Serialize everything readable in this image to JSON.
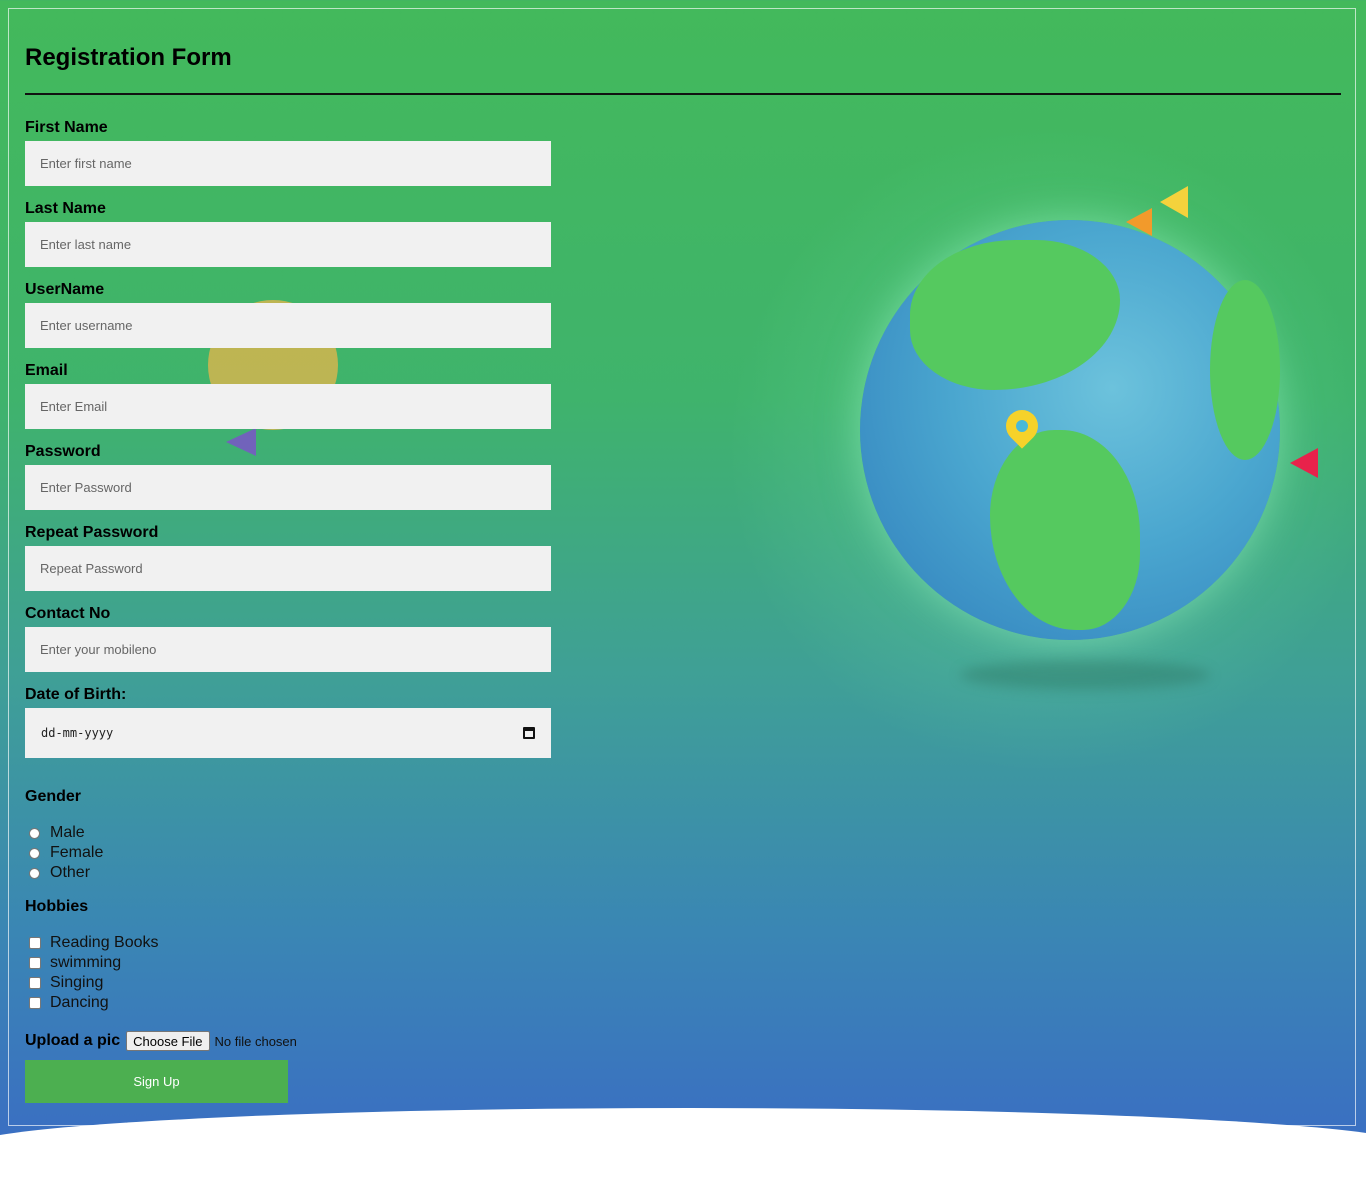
{
  "form": {
    "title": "Registration Form",
    "first_name": {
      "label": "First Name",
      "placeholder": "Enter first name"
    },
    "last_name": {
      "label": "Last Name",
      "placeholder": "Enter last name"
    },
    "username": {
      "label": "UserName",
      "placeholder": "Enter username"
    },
    "email": {
      "label": "Email",
      "placeholder": "Enter Email"
    },
    "password": {
      "label": "Password",
      "placeholder": "Enter Password"
    },
    "repeat_password": {
      "label": "Repeat Password",
      "placeholder": "Repeat Password"
    },
    "contact": {
      "label": "Contact No",
      "placeholder": "Enter your mobileno"
    },
    "dob": {
      "label": "Date of Birth:",
      "placeholder": "dd-mm-yyyy"
    },
    "gender": {
      "label": "Gender",
      "options": [
        "Male",
        "Female",
        "Other"
      ]
    },
    "hobbies": {
      "label": "Hobbies",
      "options": [
        "Reading Books",
        "swimming",
        "Singing",
        "Dancing"
      ]
    },
    "upload": {
      "label": "Upload a pic",
      "button": "Choose File",
      "status": "No file chosen"
    },
    "submit": "Sign Up"
  },
  "colors": {
    "submit_bg": "#4caf50",
    "input_bg": "#f1f1f1"
  }
}
